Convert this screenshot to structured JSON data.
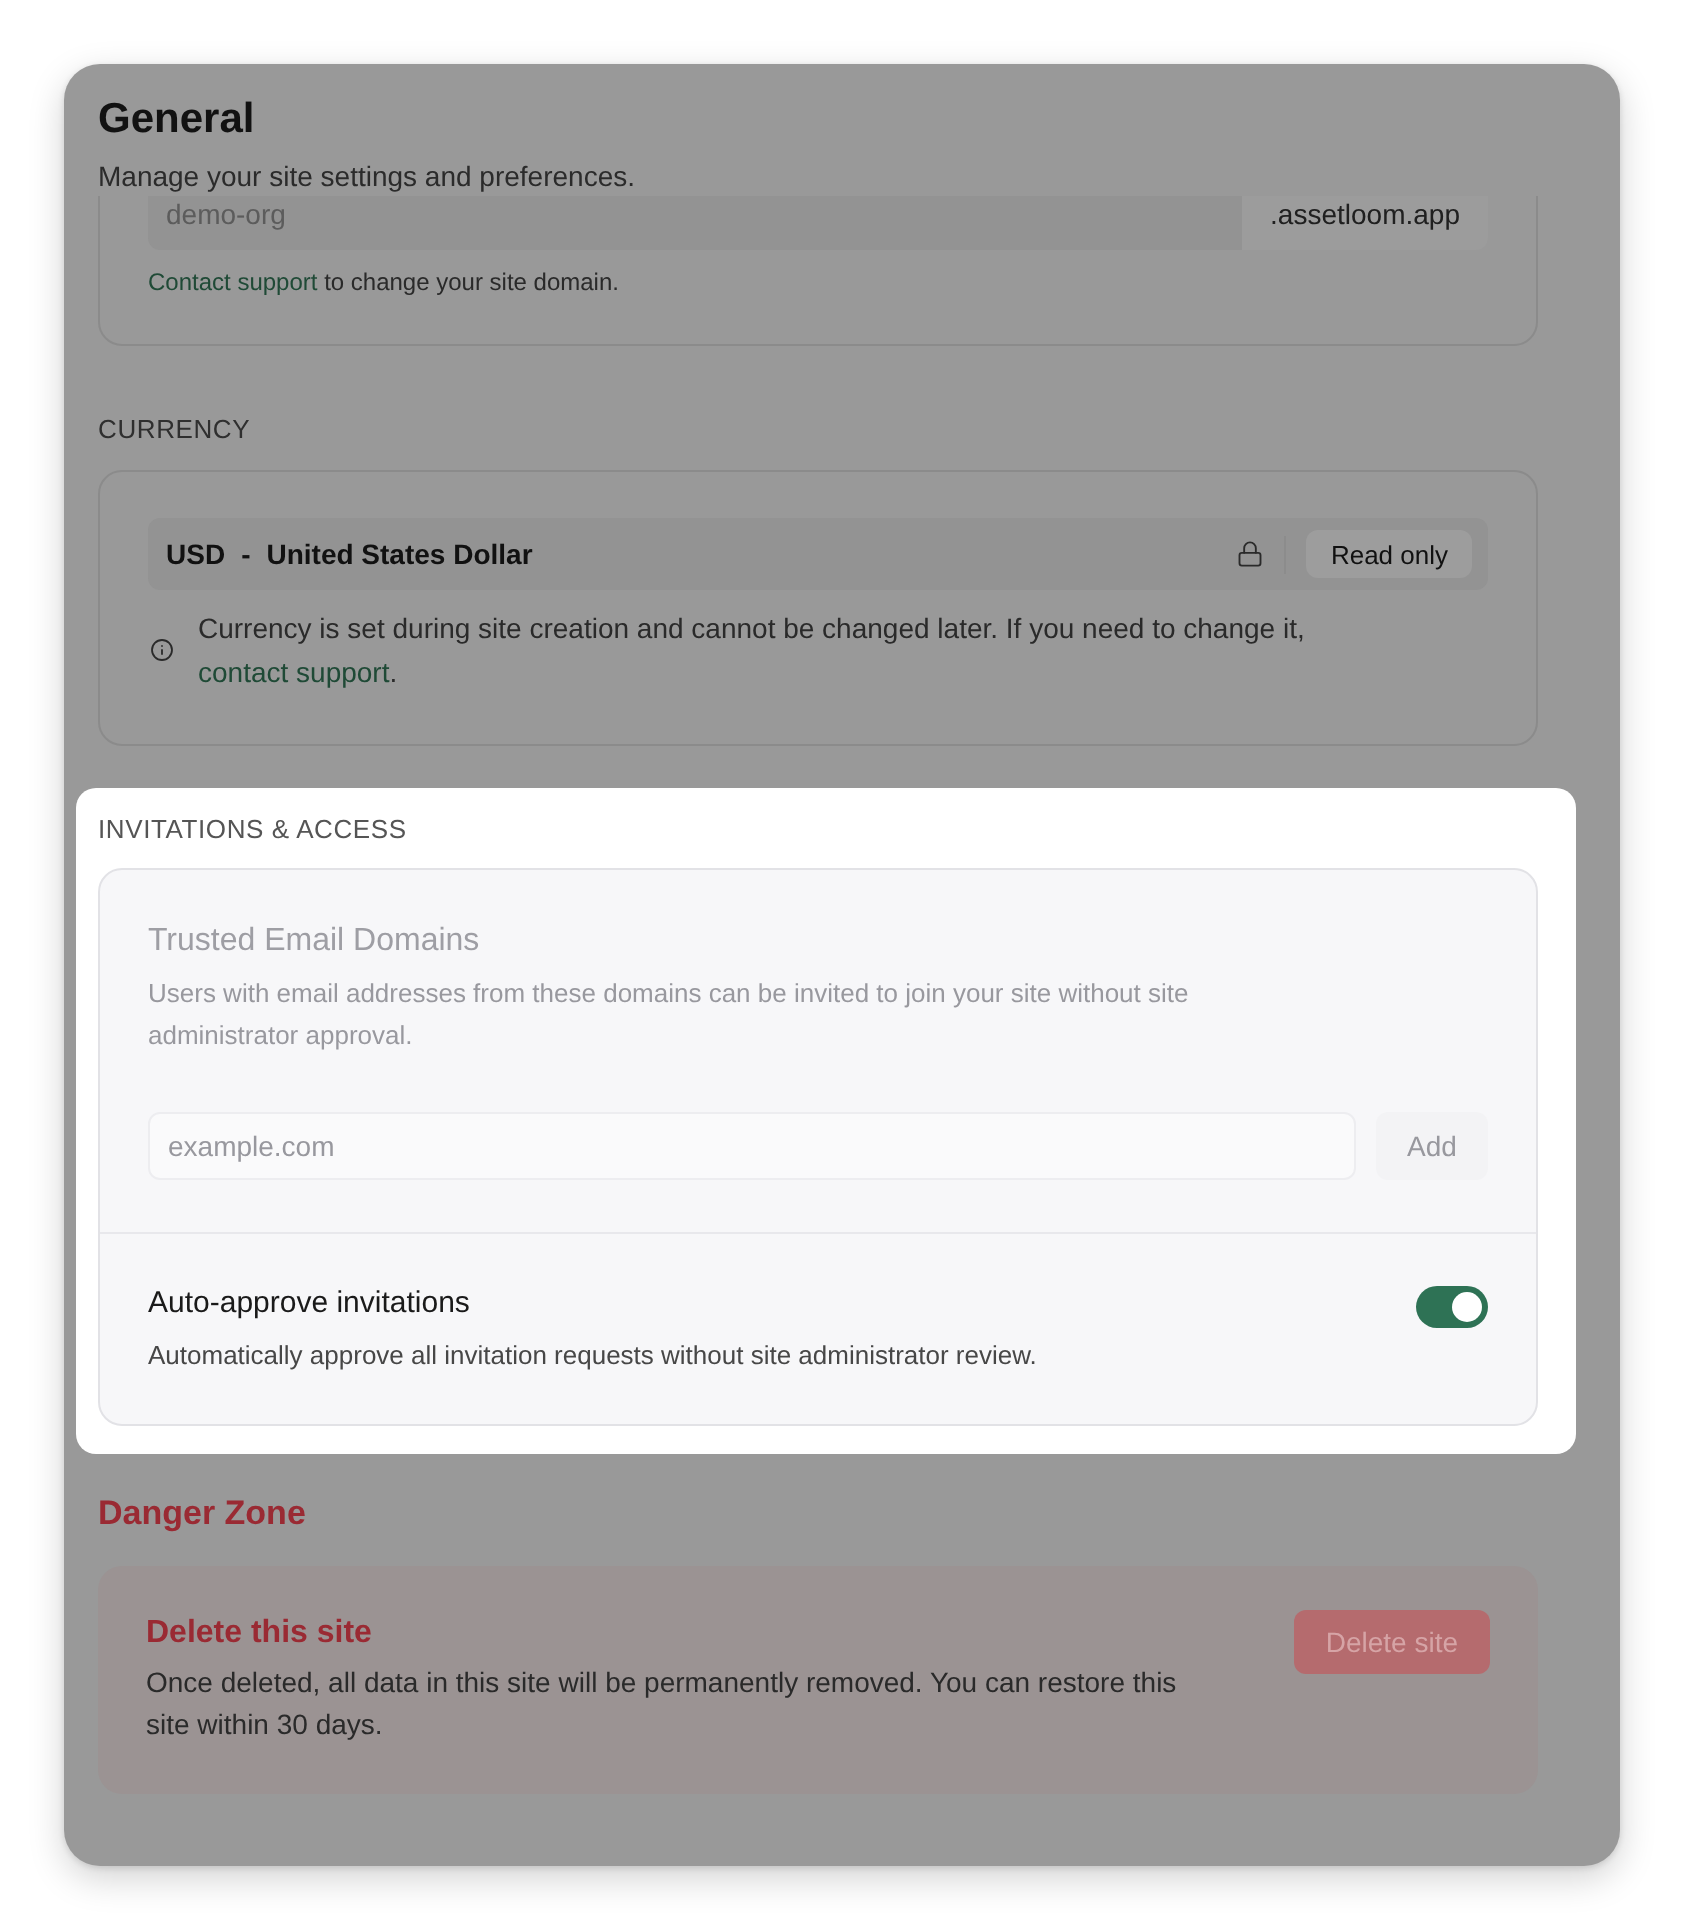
{
  "header": {
    "title": "General",
    "subtitle": "Manage your site settings and preferences."
  },
  "sections": [
    {
      "kind": "domain",
      "highlighted": false,
      "value": "demo-org",
      "suffix": ".assetloom.app",
      "note_link": "Contact support",
      "note": "to change your site domain."
    },
    {
      "kind": "currency",
      "highlighted": false,
      "label": "CURRENCY",
      "code": "USD",
      "separator": "-",
      "name": "United States Dollar",
      "locked": true,
      "badge": "Read only",
      "note": "Currency is set during site creation and cannot be changed later. If you need to change it,",
      "note_link": "contact support",
      "note_end": "."
    },
    {
      "kind": "invitations",
      "highlighted": true,
      "label": "INVITATIONS & ACCESS",
      "settings": [
        {
          "kind": "domains",
          "title": "Trusted Email Domains",
          "description": "Users with email addresses from these domains can be invited to join your site without site administrator approval.",
          "disabled": true,
          "placeholder": "example.com",
          "button": "Add"
        },
        {
          "kind": "toggle",
          "title": "Auto-approve invitations",
          "description": "Automatically approve all invitation requests without site administrator review.",
          "on": true
        }
      ]
    },
    {
      "kind": "danger",
      "highlighted": false,
      "label": "Danger Zone",
      "title": "Delete this site",
      "description": "Once deleted, all data in this site will be permanently removed. You can restore this site within 30 days.",
      "button": "Delete site"
    }
  ]
}
